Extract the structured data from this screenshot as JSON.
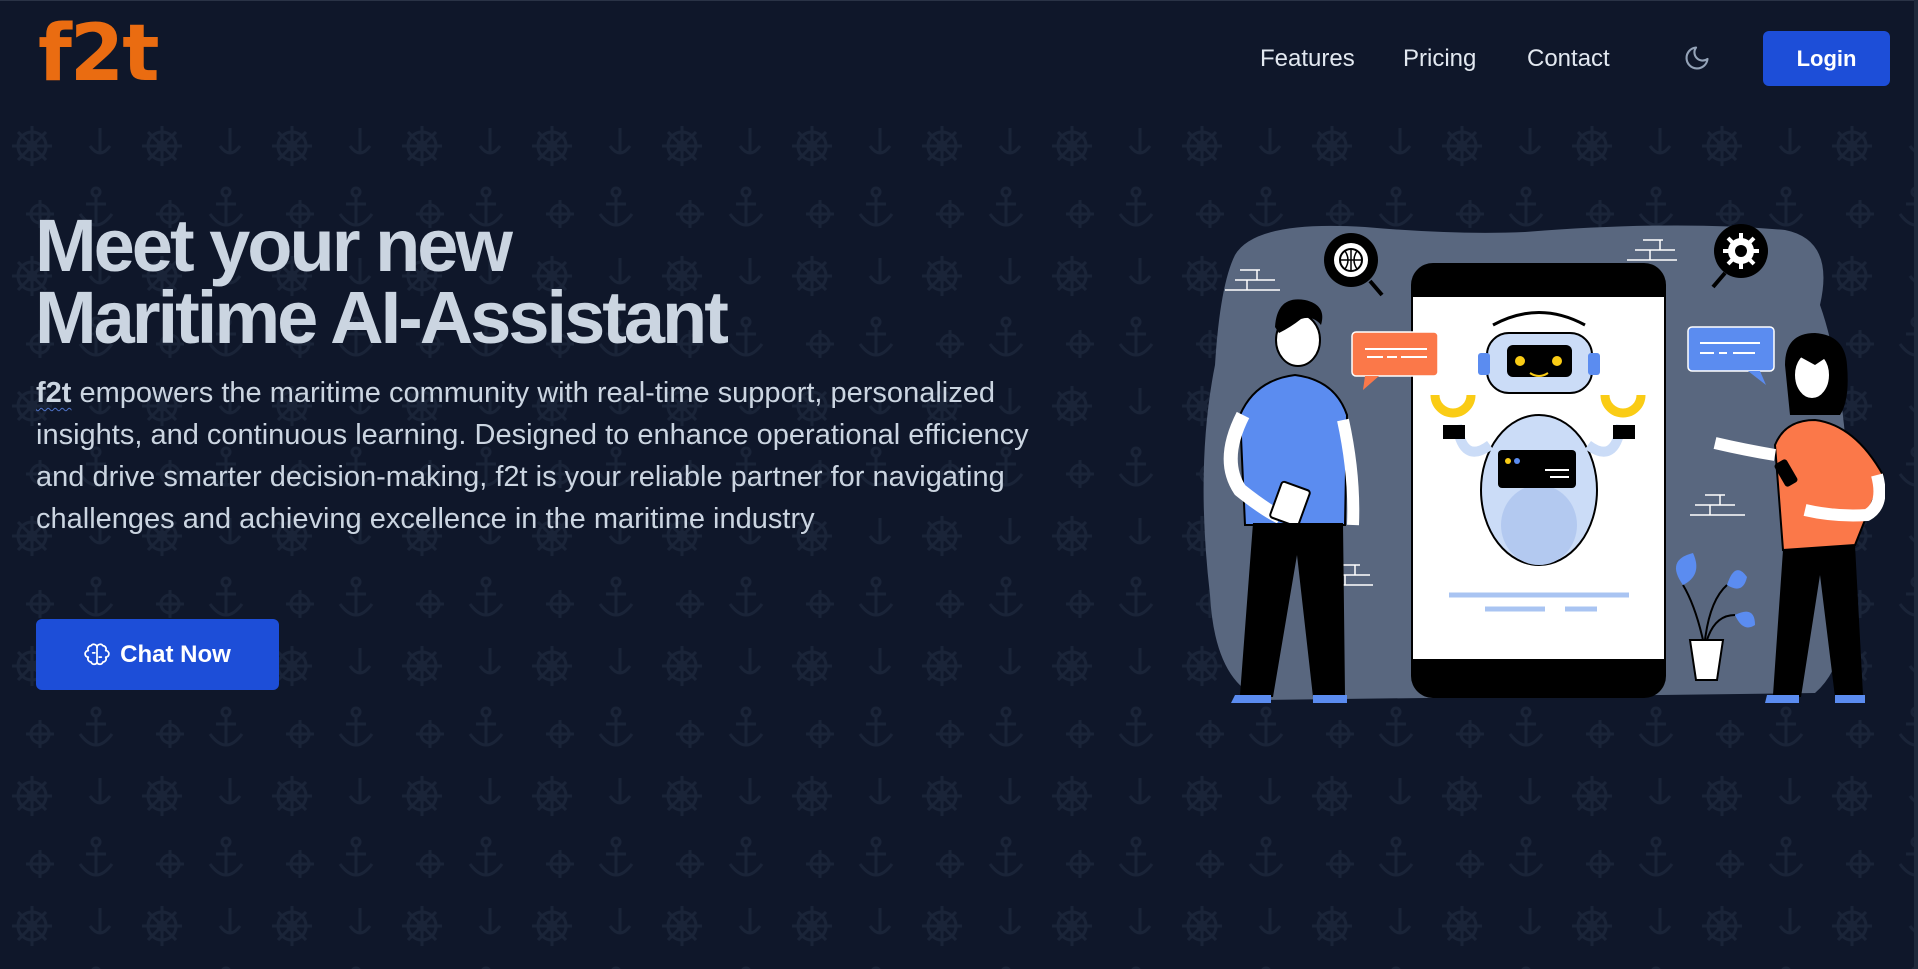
{
  "brand": {
    "logo_text": "f2t",
    "logo_color": "#ea6c11"
  },
  "nav": {
    "links": [
      "Features",
      "Pricing",
      "Contact"
    ],
    "theme_toggle_icon": "moon-icon",
    "login_label": "Login",
    "accent": "#1d4ed8"
  },
  "hero": {
    "title_line1": "Meet your new",
    "title_line2": "Maritime AI-Assistant",
    "description_brand": "f2t",
    "description": " empowers the maritime community with real-time support, personalized insights, and continuous learning. Designed to enhance operational efficiency and drive smarter decision-making, f2t is your reliable partner for navigating challenges and achieving excellence in the maritime industry",
    "cta_label": "Chat Now",
    "cta_icon": "brain-icon"
  },
  "colors": {
    "background": "#0f172a",
    "text": "#cbd5e1",
    "primary": "#1d4ed8",
    "brand_orange": "#ea6c11"
  }
}
